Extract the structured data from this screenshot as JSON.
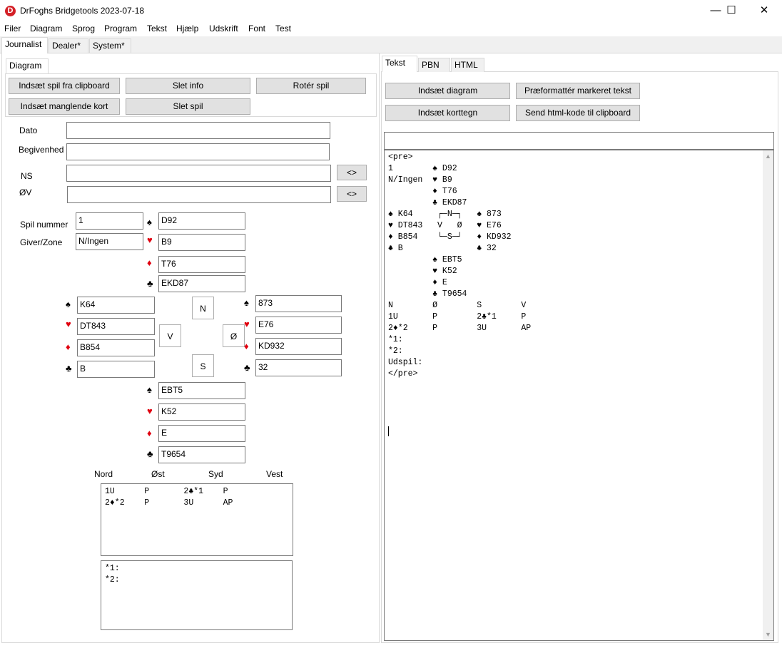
{
  "window": {
    "title": "DrFoghs Bridgetools 2023-07-18",
    "minimize": "—",
    "maximize": "☐",
    "close": "✕",
    "icon_letter": "D"
  },
  "menu": [
    "Filer",
    "Diagram",
    "Sprog",
    "Program",
    "Tekst",
    "Hjælp",
    "Udskrift",
    "Font",
    "Test"
  ],
  "top_tabs": [
    "Journalist",
    "Dealer*",
    "System*"
  ],
  "left": {
    "tab": "Diagram",
    "buttons": {
      "paste_clipboard": "Indsæt spil fra clipboard",
      "delete_info": "Slet info",
      "rotate": "Rotér spil",
      "insert_missing": "Indsæt manglende kort",
      "delete_deal": "Slet spil"
    },
    "labels": {
      "date": "Dato",
      "event": "Begivenhed",
      "ns": "NS",
      "ov": "ØV",
      "deal_no": "Spil nummer",
      "dealer_zone": "Giver/Zone"
    },
    "values": {
      "date": "",
      "event": "",
      "ns": "",
      "ov": "",
      "deal_no": "1",
      "dealer_zone": "N/Ingen"
    },
    "swap": "<>",
    "suits": {
      "spade": "♠",
      "heart": "♥",
      "diamond": "♦",
      "club": "♣"
    },
    "north": {
      "spades": "D92",
      "hearts": "B9",
      "diamonds": "T76",
      "clubs": "EKD87"
    },
    "west": {
      "spades": "K64",
      "hearts": "DT843",
      "diamonds": "B854",
      "clubs": "B"
    },
    "east": {
      "spades": "873",
      "hearts": "E76",
      "diamonds": "KD932",
      "clubs": "32"
    },
    "south": {
      "spades": "EBT5",
      "hearts": "K52",
      "diamonds": "E",
      "clubs": "T9654"
    },
    "seats": {
      "n": "N",
      "v": "V",
      "o": "Ø",
      "s": "S"
    },
    "bidding_headers": [
      "Nord",
      "Øst",
      "Syd",
      "Vest"
    ],
    "bids": [
      "1U      P       2♣*1    P",
      "2♦*2    P       3U      AP"
    ],
    "notes": [
      "*1:",
      "*2:"
    ]
  },
  "right": {
    "tabs": [
      "Tekst",
      "PBN",
      "HTML"
    ],
    "buttons": {
      "insert_diagram": "Indsæt diagram",
      "preformat": "Præformattér markeret tekst",
      "insert_suit": "Indsæt korttegn",
      "send_html": "Send html-kode til clipboard"
    },
    "input_value": "",
    "lines": [
      "",
      "<pre>",
      "1        ♠ D92",
      "N/Ingen  ♥ B9",
      "         ♦ T76",
      "         ♣ EKD87",
      "♠ K64     ┌─N─┐   ♠ 873",
      "♥ DT843   V   Ø   ♥ E76",
      "♦ B854    └─S─┘   ♦ KD932",
      "♣ B               ♣ 32",
      "         ♠ EBT5",
      "         ♥ K52",
      "         ♦ E",
      "         ♣ T9654",
      "",
      "N        Ø        S        V",
      "1U       P        2♣*1     P",
      "2♦*2     P        3U       AP",
      "*1:",
      "*2:",
      "",
      "",
      "Udspil:",
      "</pre>"
    ]
  }
}
